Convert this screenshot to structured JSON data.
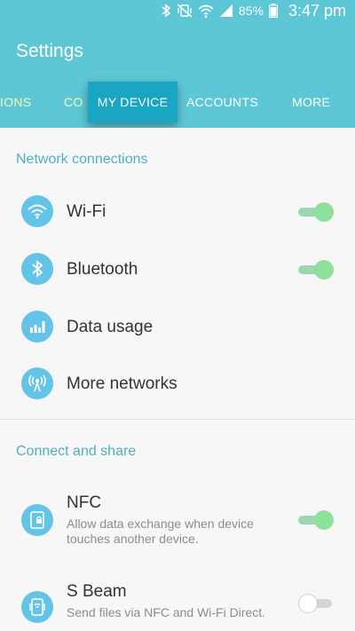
{
  "status_bar": {
    "battery": "85%",
    "time": "3:47 pm",
    "icons": [
      "bluetooth-icon",
      "mute-vibrate-icon",
      "wifi-icon",
      "signal-icon",
      "battery-icon"
    ]
  },
  "header": {
    "title": "Settings",
    "tabs": [
      {
        "label": "IONS"
      },
      {
        "label": "CO"
      },
      {
        "label": "MY DEVICE"
      },
      {
        "label": "ACCOUNTS"
      },
      {
        "label": "MORE"
      }
    ],
    "active_tab": "MY DEVICE"
  },
  "sections": [
    {
      "header": "Network connections",
      "items": [
        {
          "title": "Wi-Fi",
          "icon": "wifi-icon",
          "toggle": "on"
        },
        {
          "title": "Bluetooth",
          "icon": "bluetooth-icon",
          "toggle": "on"
        },
        {
          "title": "Data usage",
          "icon": "data-usage-icon"
        },
        {
          "title": "More networks",
          "icon": "antenna-icon"
        }
      ]
    },
    {
      "header": "Connect and share",
      "items": [
        {
          "title": "NFC",
          "subtitle": "Allow data exchange when device touches another device.",
          "icon": "nfc-icon",
          "toggle": "on"
        },
        {
          "title": "S Beam",
          "subtitle": "Send files via NFC and Wi-Fi Direct.",
          "icon": "s-beam-icon",
          "toggle": "off"
        }
      ]
    }
  ],
  "colors": {
    "header_bg": "#5ec7d6",
    "active_tab_bg": "#1aa6c2",
    "section_header": "#4fb0c1",
    "icon_bg": "#63c4e8",
    "toggle_on": "#8ee19b"
  }
}
